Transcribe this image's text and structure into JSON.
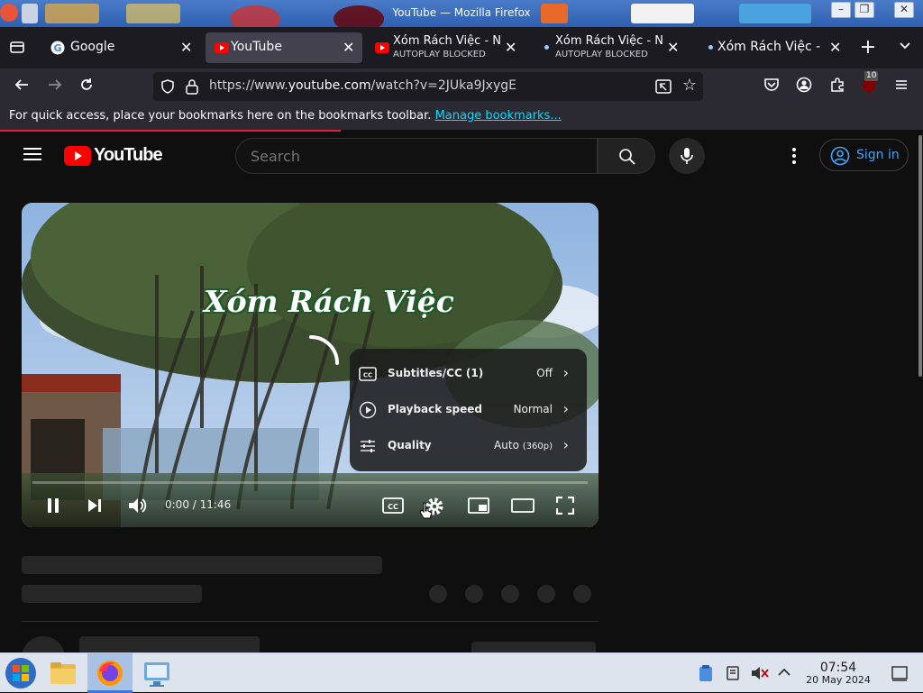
{
  "window": {
    "title": "YouTube — Mozilla Firefox"
  },
  "tabs": [
    {
      "label": "Google",
      "active": false
    },
    {
      "label": "YouTube",
      "active": true
    },
    {
      "label": "Xóm Rách Việc - N",
      "sublabel": "AUTOPLAY BLOCKED"
    },
    {
      "label": "Xóm Rách Việc - N",
      "sublabel": "AUTOPLAY BLOCKED"
    },
    {
      "label": "Xóm Rách Việc - N"
    }
  ],
  "navbar": {
    "url_prefix": "https://www.",
    "url_domain": "youtube.com",
    "url_path": "/watch?v=2JUka9JxygE",
    "extension_badge": "10"
  },
  "bookmarks_bar": {
    "message": "For quick access, place your bookmarks here on the bookmarks toolbar.",
    "link": "Manage bookmarks..."
  },
  "youtube": {
    "logo_text": "YouTube",
    "search_placeholder": "Search",
    "signin_label": "Sign in"
  },
  "video": {
    "overlay_title": "Xóm Rách Việc",
    "time": "0:00 / 11:46",
    "settings_menu": [
      {
        "label": "Subtitles/CC (1)",
        "value": "Off"
      },
      {
        "label": "Playback speed",
        "value": "Normal"
      },
      {
        "label": "Quality",
        "value": "Auto",
        "value_extra": "(360p)"
      }
    ]
  },
  "taskbar": {
    "time": "07:54",
    "date": "20 May 2024"
  },
  "colors": {
    "youtube_red": "#ff0000",
    "link_blue": "#3ea6ff",
    "firefox_accent": "#00ddff"
  }
}
